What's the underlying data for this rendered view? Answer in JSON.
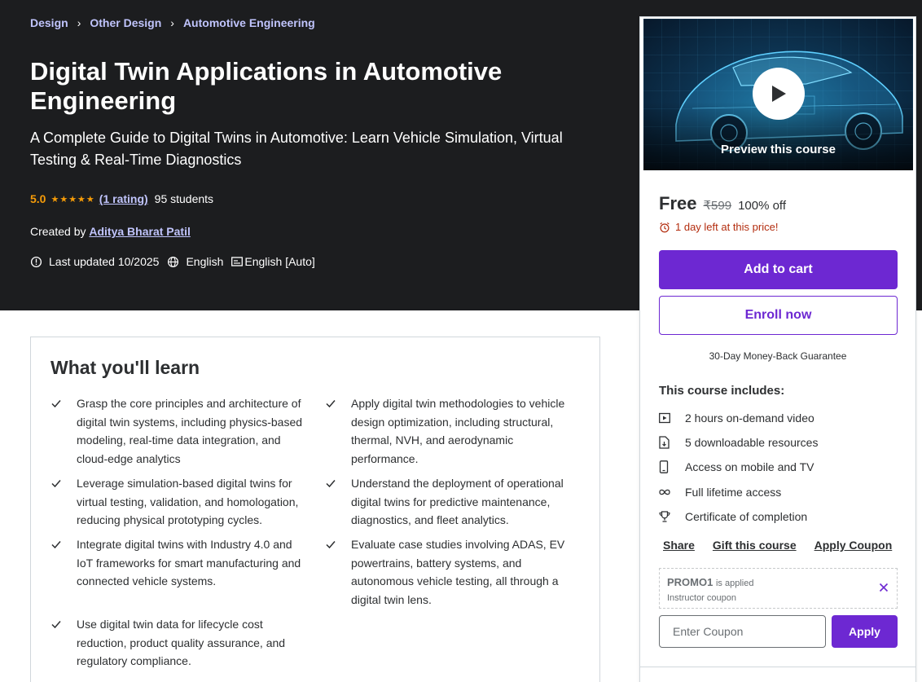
{
  "breadcrumb": [
    "Design",
    "Other Design",
    "Automotive Engineering"
  ],
  "course": {
    "title": "Digital Twin Applications in Automotive Engineering",
    "subtitle": "A Complete Guide to Digital Twins in Automotive: Learn Vehicle Simulation, Virtual Testing & Real-Time Diagnostics",
    "rating": "5.0",
    "stars": 5,
    "rating_link": "(1 rating)",
    "students": "95 students",
    "created_by_label": "Created by",
    "instructor": "Aditya Bharat Patil",
    "last_updated": "Last updated 10/2025",
    "language": "English",
    "captions": "English [Auto]"
  },
  "learn": {
    "title": "What you'll learn",
    "items": [
      "Grasp the core principles and architecture of digital twin systems, including physics-based modeling, real-time data integration, and cloud-edge analytics",
      "Apply digital twin methodologies to vehicle design optimization, including structural, thermal, NVH, and aerodynamic performance.",
      "Leverage simulation-based digital twins for virtual testing, validation, and homologation, reducing physical prototyping cycles.",
      "Understand the deployment of operational digital twins for predictive maintenance, diagnostics, and fleet analytics.",
      "Integrate digital twins with Industry 4.0 and IoT frameworks for smart manufacturing and connected vehicle systems.",
      "Evaluate case studies involving ADAS, EV powertrains, battery systems, and autonomous vehicle testing, all through a digital twin lens.",
      "Use digital twin data for lifecycle cost reduction, product quality assurance, and regulatory compliance."
    ]
  },
  "sidebar": {
    "preview_label": "Preview this course",
    "price": "Free",
    "original_price": "₹599",
    "discount": "100% off",
    "timer": "1 day left at this price!",
    "add_to_cart": "Add to cart",
    "enroll_now": "Enroll now",
    "guarantee": "30-Day Money-Back Guarantee",
    "includes_title": "This course includes:",
    "includes": [
      {
        "icon": "video-icon",
        "label": "2 hours on-demand video"
      },
      {
        "icon": "file-download-icon",
        "label": "5 downloadable resources"
      },
      {
        "icon": "mobile-icon",
        "label": "Access on mobile and TV"
      },
      {
        "icon": "infinity-icon",
        "label": "Full lifetime access"
      },
      {
        "icon": "trophy-icon",
        "label": "Certificate of completion"
      }
    ],
    "links": [
      "Share",
      "Gift this course",
      "Apply Coupon"
    ],
    "coupon": {
      "code": "PROMO1",
      "applied_text": "is applied",
      "type": "Instructor coupon",
      "input_placeholder": "Enter Coupon",
      "apply_label": "Apply"
    }
  },
  "colors": {
    "hero_bg": "#1c1d1f",
    "accent": "#6d28d2",
    "link_light": "#c0c4fc",
    "star": "#f69c08",
    "timer": "#b32d0f"
  }
}
